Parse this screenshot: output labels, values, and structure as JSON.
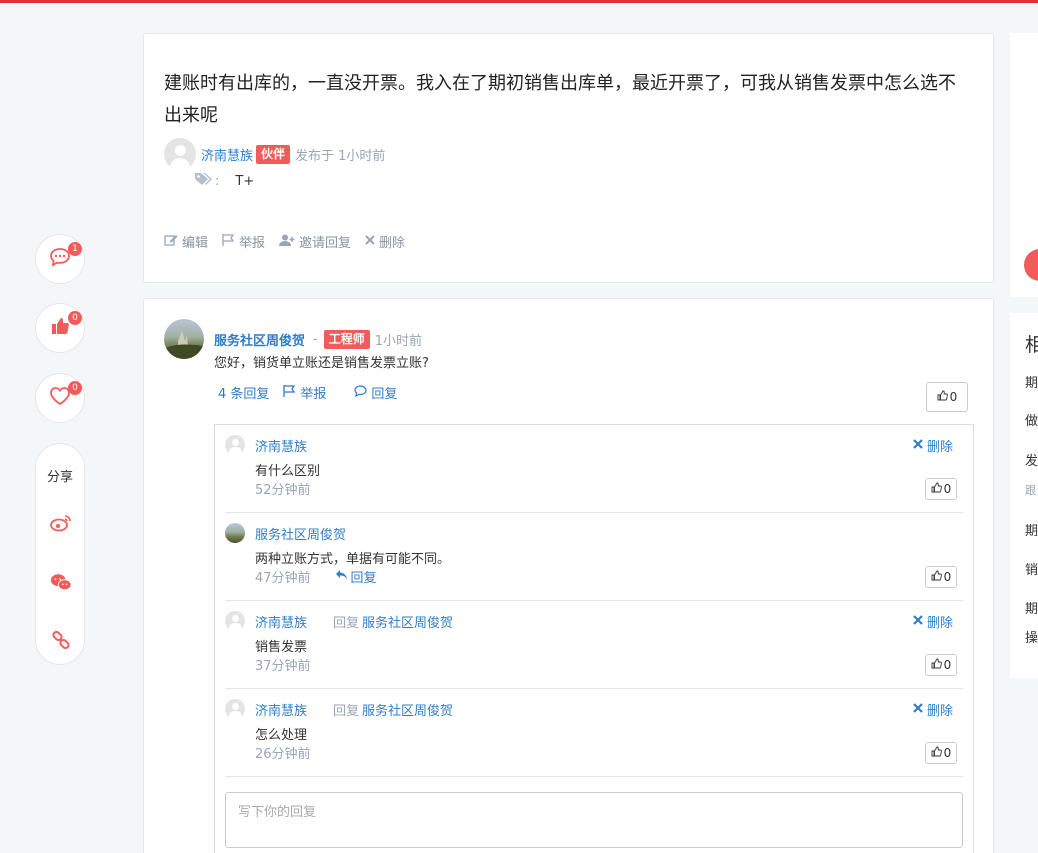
{
  "question": {
    "title": "建账时有出库的，一直没开票。我入在了期初销售出库单，最近开票了，可我从销售发票中怎么选不出来呢",
    "author": "济南慧族",
    "author_badge": "伙伴",
    "posted": "发布于 1小时前",
    "tag_sep": ":",
    "tag": "T+",
    "actions": {
      "edit": "编辑",
      "report": "举报",
      "invite": "邀请回复",
      "delete": "删除"
    }
  },
  "side_actions": {
    "comments_count": "1",
    "likes_count": "0",
    "favorites_count": "0",
    "share_label": "分享"
  },
  "answer": {
    "author": "服务社区周俊贺",
    "dash": "-",
    "author_badge": "工程师",
    "time": "1小时前",
    "text": "您好，销货单立账还是销售发票立账?",
    "replies_link": "4 条回复",
    "report": "举报",
    "reply": "回复",
    "likes": "0"
  },
  "comments": [
    {
      "author": "济南慧族",
      "reply_prefix": "",
      "reply_to": "",
      "text": "有什么区别",
      "time": "52分钟前",
      "delete": "删除",
      "reply": "",
      "likes": "0"
    },
    {
      "author": "服务社区周俊贺",
      "reply_prefix": "",
      "reply_to": "",
      "text": "两种立账方式，单据有可能不同。",
      "time": "47分钟前",
      "delete": "",
      "reply": "回复",
      "likes": "0"
    },
    {
      "author": "济南慧族",
      "reply_prefix": "回复",
      "reply_to": "服务社区周俊贺",
      "text": "销售发票",
      "time": "37分钟前",
      "delete": "删除",
      "reply": "",
      "likes": "0"
    },
    {
      "author": "济南慧族",
      "reply_prefix": "回复",
      "reply_to": "服务社区周俊贺",
      "text": "怎么处理",
      "time": "26分钟前",
      "delete": "删除",
      "reply": "",
      "likes": "0"
    }
  ],
  "reply_placeholder": "写下你的回复",
  "right_column": {
    "heading": "相",
    "items": [
      "期",
      "做",
      "发",
      "跟",
      "期",
      "销",
      "期",
      "操"
    ]
  }
}
